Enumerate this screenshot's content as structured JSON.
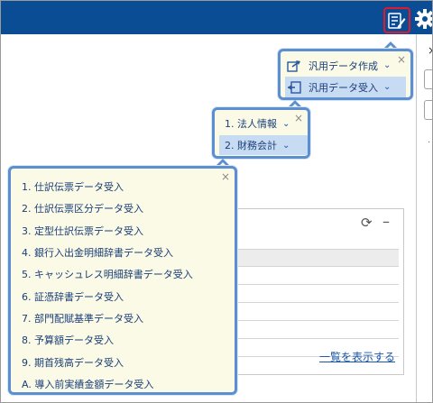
{
  "colors": {
    "topbar": "#0a4d94",
    "highlight": "#e0192b",
    "popup_border": "#5c8fd0",
    "popup_bg": "#fafae7",
    "selected_bg": "#c7dbf2"
  },
  "header": {
    "icons": [
      "data-list-edit-icon",
      "gear-icon"
    ]
  },
  "right_panel": {
    "close_glyph": "×",
    "dot": "·"
  },
  "panel": {
    "refresh_glyph": "⟳",
    "minimize_glyph": "–",
    "more_link": "一覧を表示する"
  },
  "popup_general": {
    "close_glyph": "×",
    "items": [
      {
        "label": "汎用データ作成",
        "icon": "export-icon",
        "chevron": "⌄"
      },
      {
        "label": "汎用データ受入",
        "icon": "import-icon",
        "chevron": "⌄"
      }
    ]
  },
  "popup_category": {
    "close_glyph": "×",
    "items": [
      {
        "label": "1. 法人情報",
        "chevron": "⌄"
      },
      {
        "label": "2. 財務会計",
        "chevron": "⌄"
      }
    ]
  },
  "popup_import": {
    "close_glyph": "×",
    "items": [
      "1. 仕訳伝票データ受入",
      "2. 仕訳伝票区分データ受入",
      "3. 定型仕訳伝票データ受入",
      "4. 銀行入出金明細辞書データ受入",
      "5. キャッシュレス明細辞書データ受入",
      "6. 証憑辞書データ受入",
      "7. 部門配賦基準データ受入",
      "8. 予算額データ受入",
      "9. 期首残高データ受入",
      "A. 導入前実績金額データ受入"
    ]
  }
}
